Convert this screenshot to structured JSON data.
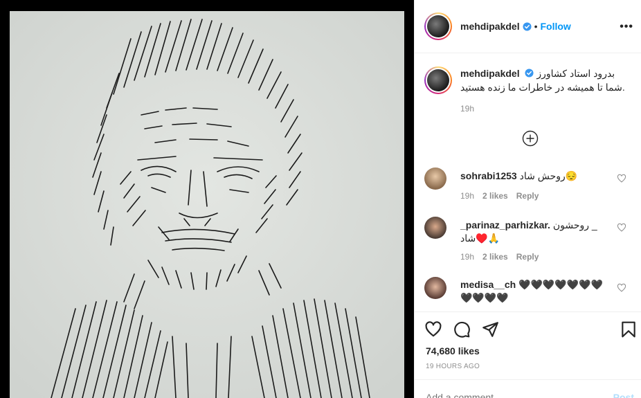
{
  "post": {
    "author": "mehdipakdel",
    "follow_label": "Follow",
    "separator": "•",
    "more_label": "•••"
  },
  "caption": {
    "username": "mehdipakdel",
    "line1": "بدرود استاد کشاورز",
    "line2": "شما تا همیشه در خاطرات ما زنده هستید.",
    "time": "19h"
  },
  "comments": [
    {
      "username": "sohrabi1253",
      "text": "روحش شاد😔",
      "time": "19h",
      "likes": "2 likes",
      "reply": "Reply"
    },
    {
      "username": "_parinaz_parhizkar.",
      "text": "روحشون _",
      "text2": "شاد♥️🙏",
      "time": "19h",
      "likes": "2 likes",
      "reply": "Reply"
    },
    {
      "username": "medisa__ch",
      "text": "🖤🖤🖤🖤🖤🖤🖤",
      "text2": "🖤🖤🖤🖤"
    }
  ],
  "stats": {
    "likes": "74,680 likes",
    "posted": "19 HOURS AGO"
  },
  "comment_box": {
    "placeholder": "Add a comment…",
    "post_label": "Post"
  },
  "colors": {
    "accent": "#0095f6",
    "muted": "#8e8e8e",
    "photo_bg": "#dfe2df"
  }
}
